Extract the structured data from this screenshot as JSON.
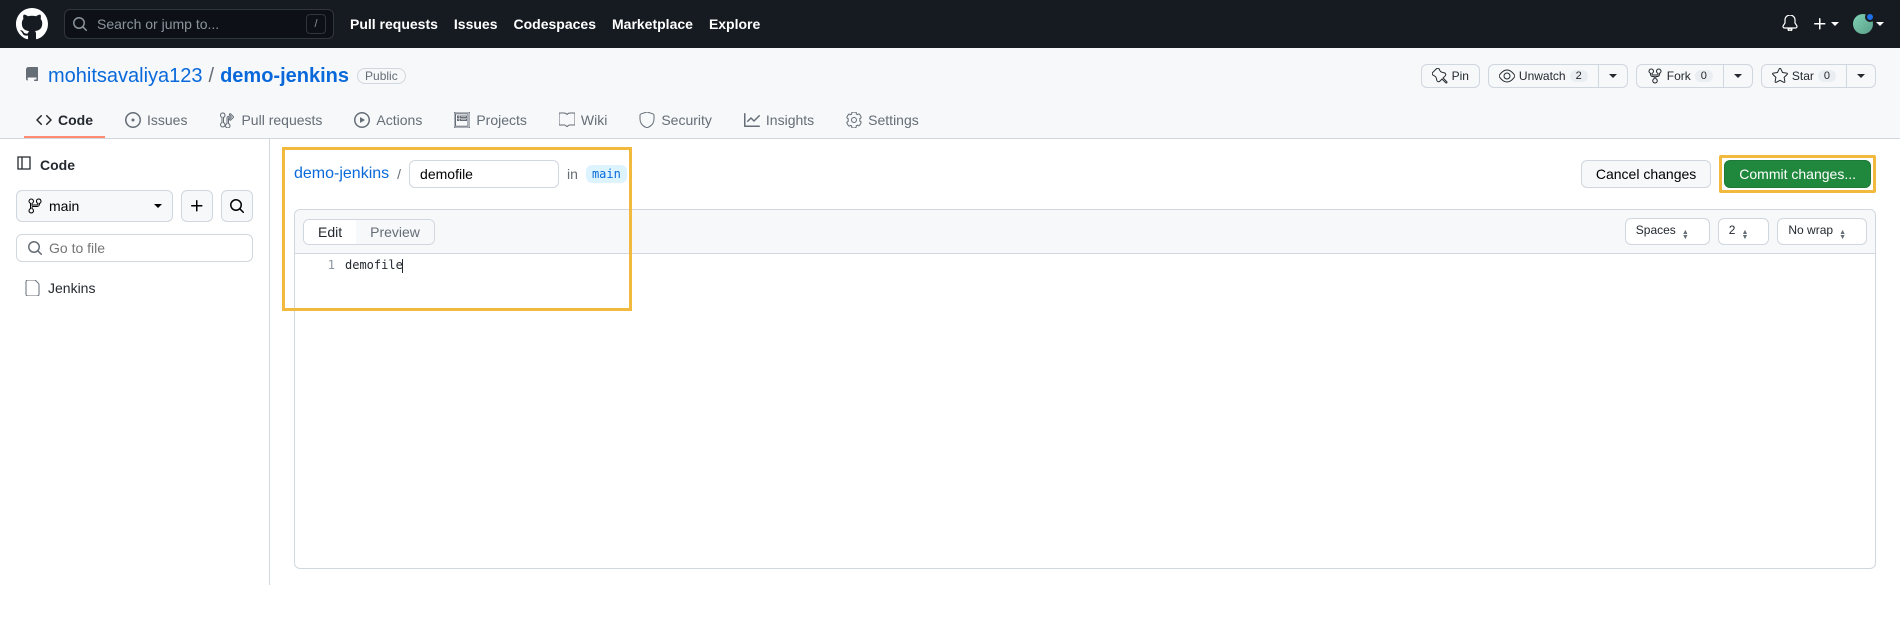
{
  "header": {
    "search_placeholder": "Search or jump to...",
    "nav": [
      "Pull requests",
      "Issues",
      "Codespaces",
      "Marketplace",
      "Explore"
    ]
  },
  "repo": {
    "owner": "mohitsavaliya123",
    "name": "demo-jenkins",
    "visibility": "Public",
    "actions": {
      "pin": "Pin",
      "watch": "Unwatch",
      "watch_count": "2",
      "fork": "Fork",
      "fork_count": "0",
      "star": "Star",
      "star_count": "0"
    },
    "tabs": [
      "Code",
      "Issues",
      "Pull requests",
      "Actions",
      "Projects",
      "Wiki",
      "Security",
      "Insights",
      "Settings"
    ]
  },
  "sidebar": {
    "title": "Code",
    "branch": "main",
    "filter_placeholder": "Go to file",
    "files": [
      "Jenkins"
    ]
  },
  "editor": {
    "crumb_repo": "demo-jenkins",
    "filename": "demofile",
    "in": "in",
    "branch": "main",
    "cancel": "Cancel changes",
    "commit": "Commit changes...",
    "tabs": {
      "edit": "Edit",
      "preview": "Preview"
    },
    "indent_mode": "Spaces",
    "indent_size": "2",
    "wrap_mode": "No wrap",
    "line1_num": "1",
    "line1_text": "demofile"
  }
}
